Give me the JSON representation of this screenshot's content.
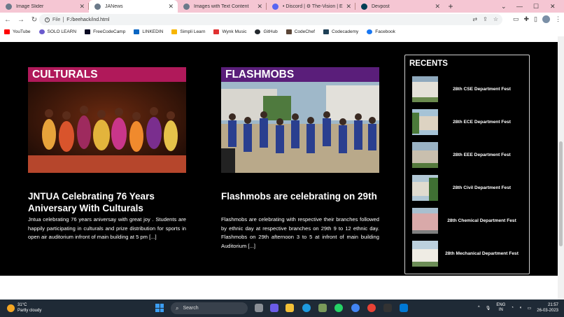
{
  "tabs": [
    {
      "title": "Image Slider",
      "active": false,
      "color": "#6b7a8a"
    },
    {
      "title": "JANews",
      "active": true,
      "color": "#6b7a8a"
    },
    {
      "title": "Images with Text Content",
      "active": false,
      "color": "#6b7a8a"
    },
    {
      "title": "• Discord | ⚙ The-Vision | En",
      "active": false,
      "color": "#5865f2"
    },
    {
      "title": "Devpost",
      "active": false,
      "color": "#003e54"
    }
  ],
  "address": {
    "scheme": "File",
    "path": "F:/beehack/ind.html"
  },
  "bookmarks": [
    {
      "label": "YouTube",
      "icon": "youtube-icon",
      "color": "#ff0000"
    },
    {
      "label": "SOLO LEARN",
      "icon": "sololearn-icon",
      "color": "#6a5acd"
    },
    {
      "label": "FreeCodeCamp",
      "icon": "freecodecamp-icon",
      "color": "#0a0a23"
    },
    {
      "label": "LINKEDIN",
      "icon": "linkedin-icon",
      "color": "#0a66c2"
    },
    {
      "label": "Simpli Learn",
      "icon": "simplilearn-icon",
      "color": "#f7b500"
    },
    {
      "label": "Wynk Music",
      "icon": "wynk-icon",
      "color": "#e03131"
    },
    {
      "label": "GitHub",
      "icon": "github-icon",
      "color": "#24292e"
    },
    {
      "label": "CodeChef",
      "icon": "codechef-icon",
      "color": "#5b4638"
    },
    {
      "label": "Codecademy",
      "icon": "codecademy-icon",
      "color": "#1f4056"
    },
    {
      "label": "Facebook",
      "icon": "facebook-icon",
      "color": "#1877f2"
    }
  ],
  "cards": [
    {
      "category": "CULTURALS",
      "category_color": "#b0195a",
      "headline": "JNTUA Celebrating 76 Years Aniversary With Culturals",
      "excerpt": "Jntua celebrating 76 years aniversay with great joy . Students are happily participating in culturals and prize distribution for sports in open air auditorium infront of main building at 5 pm [...]"
    },
    {
      "category": "FLASHMOBS",
      "category_color": "#5a1e7a",
      "headline": "Flashmobs are celebrating on 29th",
      "excerpt": "Flashmobs are celebrating with respective their branches followed by ethnic day at respective branches on 29th 9 to 12 ethnic day. Flashmobs on 29th afternoon 3 to 5 at infront of main building Auditorium [...]"
    }
  ],
  "recent": {
    "title": "RECENTS",
    "items": [
      "28th CSE Department Fest",
      "28th ECE Department Fest",
      "28th EEE Department Fest",
      "28th Civil Department Fest",
      "28th Chemical Department Fest",
      "28th Mechanical Department Fest"
    ]
  },
  "taskbar": {
    "temp": "31°C",
    "weather": "Partly cloudy",
    "search_label": "Search",
    "lang1": "ENG",
    "lang2": "IN",
    "time": "21:57",
    "date": "26-03-2023"
  }
}
